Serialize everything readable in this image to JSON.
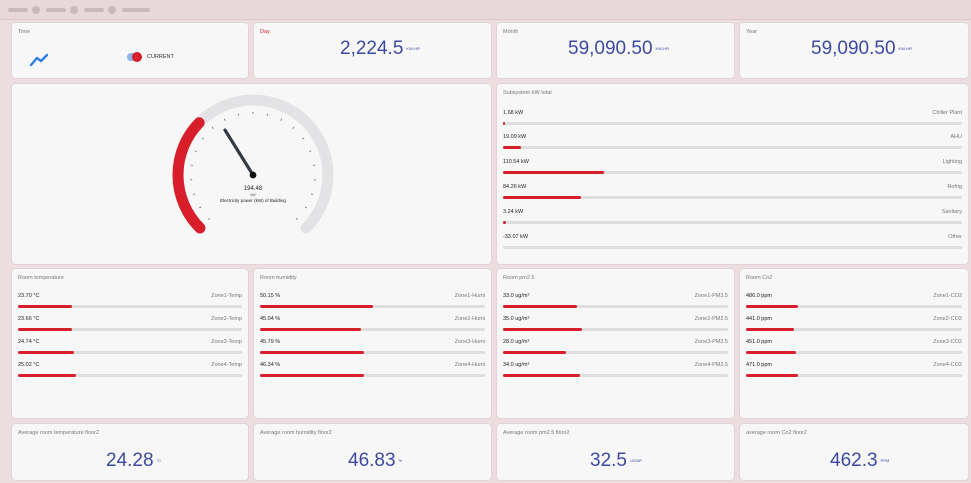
{
  "colors": {
    "accent": "#d81e2b",
    "value_blue": "#3d4aa0",
    "toggle_track": "#8fb2e8",
    "trend_icon": "#2f7de1"
  },
  "time_panel": {
    "title": "Time",
    "icon": "trend-line-icon",
    "toggle_label": "CURRENT",
    "toggle_on": true
  },
  "day": {
    "title": "Day",
    "value": "2,224.5",
    "unit": "KW-HR"
  },
  "month": {
    "title": "Month",
    "value": "59,090.50",
    "unit": "KW-HR"
  },
  "year": {
    "title": "Year",
    "value": "59,090.50",
    "unit": "KW-HR"
  },
  "gauge": {
    "value_text": "194.48",
    "unit": "kW",
    "caption": "Electricity power (kW) of Building",
    "fraction": 0.33
  },
  "subsystem": {
    "title": "Subsystem kW total",
    "rows": [
      {
        "value": "1.68 kW",
        "label": "Chiller Plant",
        "fraction": 0.004
      },
      {
        "value": "19.09 kW",
        "label": "AHU",
        "fraction": 0.04
      },
      {
        "value": "110.54 kW",
        "label": "Lighting",
        "fraction": 0.22
      },
      {
        "value": "84.26 kW",
        "label": "Refrig",
        "fraction": 0.17
      },
      {
        "value": "3.24 kW",
        "label": "Sanitary",
        "fraction": 0.007
      },
      {
        "value": "-33.07 kW",
        "label": "Other",
        "fraction": 0
      }
    ]
  },
  "room_temperature": {
    "title": "Room temperature",
    "rows": [
      {
        "value": "23.70 °C",
        "label": "Zone1-Temp",
        "fraction": 0.24
      },
      {
        "value": "23.66 °C",
        "label": "Zone2-Temp",
        "fraction": 0.24
      },
      {
        "value": "24.74 °C",
        "label": "Zone3-Temp",
        "fraction": 0.25
      },
      {
        "value": "25.02 °C",
        "label": "Zone4-Temp",
        "fraction": 0.26
      }
    ]
  },
  "room_humidity": {
    "title": "Room humidity",
    "rows": [
      {
        "value": "50.15 %",
        "label": "Zone1-Humi",
        "fraction": 0.5
      },
      {
        "value": "45.04 %",
        "label": "Zone2-Humi",
        "fraction": 0.45
      },
      {
        "value": "45.79 %",
        "label": "Zone3-Humi",
        "fraction": 0.46
      },
      {
        "value": "46.34 %",
        "label": "Zone4-Humi",
        "fraction": 0.46
      }
    ]
  },
  "room_pm25": {
    "title": "Room pm2.5",
    "rows": [
      {
        "value": "33.0 ug/m³",
        "label": "Zone1-PM2.5",
        "fraction": 0.33
      },
      {
        "value": "35.0 ug/m³",
        "label": "Zone2-PM2.5",
        "fraction": 0.35
      },
      {
        "value": "28.0 ug/m³",
        "label": "Zone3-PM2.5",
        "fraction": 0.28
      },
      {
        "value": "34.0 ug/m³",
        "label": "Zone4-PM2.5",
        "fraction": 0.34
      }
    ]
  },
  "room_co2": {
    "title": "Room Co2",
    "rows": [
      {
        "value": "486.0 ppm",
        "label": "Zone1-CO2",
        "fraction": 0.24
      },
      {
        "value": "441.0 ppm",
        "label": "Zone2-CO2",
        "fraction": 0.22
      },
      {
        "value": "451.0 ppm",
        "label": "Zone3-CO2",
        "fraction": 0.23
      },
      {
        "value": "471.0 ppm",
        "label": "Zone4-CO2",
        "fraction": 0.24
      }
    ]
  },
  "avg_temp": {
    "title": "Average room temperature floor2",
    "value": "24.28",
    "unit": "°C"
  },
  "avg_humidity": {
    "title": "Average room humidity floor2",
    "value": "46.83",
    "unit": "%"
  },
  "avg_pm25": {
    "title": "Average room pm2.5 floor2",
    "value": "32.5",
    "unit": "UG/M³"
  },
  "avg_co2": {
    "title": "average room Co2 floor2",
    "value": "462.3",
    "unit": "PPM"
  }
}
